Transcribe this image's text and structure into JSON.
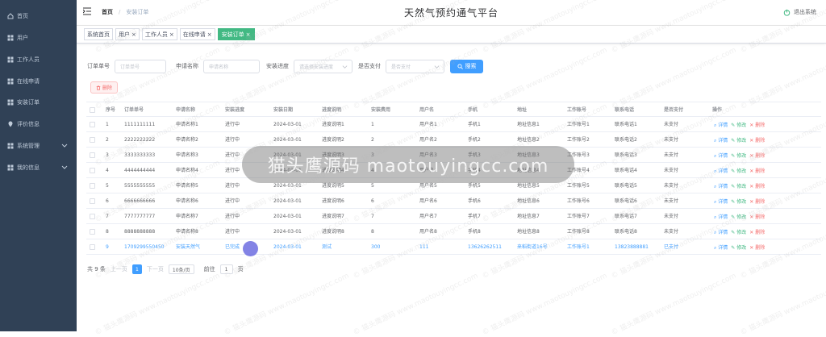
{
  "sidebar": {
    "items": [
      {
        "label": "首页",
        "icon": "home-icon"
      },
      {
        "label": "用户",
        "icon": "grid-icon"
      },
      {
        "label": "工作人员",
        "icon": "grid-icon"
      },
      {
        "label": "在线申请",
        "icon": "grid-icon"
      },
      {
        "label": "安装订单",
        "icon": "grid-icon"
      },
      {
        "label": "评价信息",
        "icon": "location-icon"
      },
      {
        "label": "系统管理",
        "icon": "grid-icon"
      },
      {
        "label": "我的信息",
        "icon": "grid-icon"
      }
    ]
  },
  "header": {
    "breadcrumb_home": "首页",
    "breadcrumb_sep": "/",
    "breadcrumb_current": "安装订单",
    "title": "天然气预约通气平台",
    "logout": "退出系统"
  },
  "tabs": [
    {
      "label": "系统首页",
      "closable": false
    },
    {
      "label": "用户",
      "closable": true
    },
    {
      "label": "工作人员",
      "closable": true
    },
    {
      "label": "在线申请",
      "closable": true
    },
    {
      "label": "安装订单",
      "closable": true,
      "active": true
    }
  ],
  "search": {
    "order_no_label": "订单单号",
    "order_no_placeholder": "订单单号",
    "apply_name_label": "申请名称",
    "apply_name_placeholder": "申请名称",
    "progress_label": "安装进度",
    "progress_placeholder": "请选择安装进度",
    "paid_label": "是否支付",
    "paid_placeholder": "是否支付",
    "search_button": "搜索"
  },
  "delete_button": "删除",
  "table": {
    "headers": [
      "序号",
      "订单单号",
      "申请名称",
      "安装进度",
      "安装日期",
      "进度说明",
      "安装费用",
      "用户名",
      "手机",
      "地址",
      "工作账号",
      "联系电话",
      "是否支付",
      "操作"
    ],
    "rows": [
      [
        "1",
        "1111111111",
        "申请名称1",
        "进行中",
        "2024-03-01",
        "进度说明1",
        "1",
        "用户名1",
        "手机1",
        "地址信息1",
        "工作账号1",
        "联系电话1",
        "未支付"
      ],
      [
        "2",
        "2222222222",
        "申请名称2",
        "进行中",
        "2024-03-01",
        "进度说明2",
        "2",
        "用户名2",
        "手机2",
        "地址信息2",
        "工作账号2",
        "联系电话2",
        "未支付"
      ],
      [
        "3",
        "3333333333",
        "申请名称3",
        "进行中",
        "2024-03-01",
        "进度说明3",
        "3",
        "用户名3",
        "手机3",
        "地址信息3",
        "工作账号3",
        "联系电话3",
        "未支付"
      ],
      [
        "4",
        "4444444444",
        "申请名称4",
        "进行中",
        "2024-03-01",
        "进度说明4",
        "4",
        "用户名4",
        "手机4",
        "地址信息4",
        "工作账号4",
        "联系电话4",
        "未支付"
      ],
      [
        "5",
        "5555555555",
        "申请名称5",
        "进行中",
        "2024-03-01",
        "进度说明5",
        "5",
        "用户名5",
        "手机5",
        "地址信息5",
        "工作账号5",
        "联系电话5",
        "未支付"
      ],
      [
        "6",
        "6666666666",
        "申请名称6",
        "进行中",
        "2024-03-01",
        "进度说明6",
        "6",
        "用户名6",
        "手机6",
        "地址信息6",
        "工作账号6",
        "联系电话6",
        "未支付"
      ],
      [
        "7",
        "7777777777",
        "申请名称7",
        "进行中",
        "2024-03-01",
        "进度说明7",
        "7",
        "用户名7",
        "手机7",
        "地址信息7",
        "工作账号7",
        "联系电话7",
        "未支付"
      ],
      [
        "8",
        "8888888888",
        "申请名称8",
        "进行中",
        "2024-03-01",
        "进度说明8",
        "8",
        "用户名8",
        "手机8",
        "地址信息8",
        "工作账号8",
        "联系电话8",
        "未支付"
      ],
      [
        "9",
        "1709299550450",
        "安装天然气",
        "已完成",
        "2024-03-01",
        "测试",
        "300",
        "111",
        "13626262511",
        "来稻街道16号",
        "工作账号1",
        "13823888881",
        "已支付"
      ]
    ],
    "ops": {
      "view": "详情",
      "edit": "修改",
      "delete": "删除"
    }
  },
  "pager": {
    "total": "共 9 条",
    "prev": "上一页",
    "page": "1",
    "next": "下一页",
    "size": "10条/页",
    "goto": "前往",
    "goto_value": "1",
    "page_unit": "页"
  },
  "overlay_text": "猫头鹰源码 maotouyingcc.com",
  "watermark": "© 猫头鹰源码 www.maotouyingcc.com",
  "colors": {
    "sidebar_bg": "#304156",
    "primary": "#409eff",
    "active_tab": "#42b983",
    "danger": "#f56c6c"
  }
}
